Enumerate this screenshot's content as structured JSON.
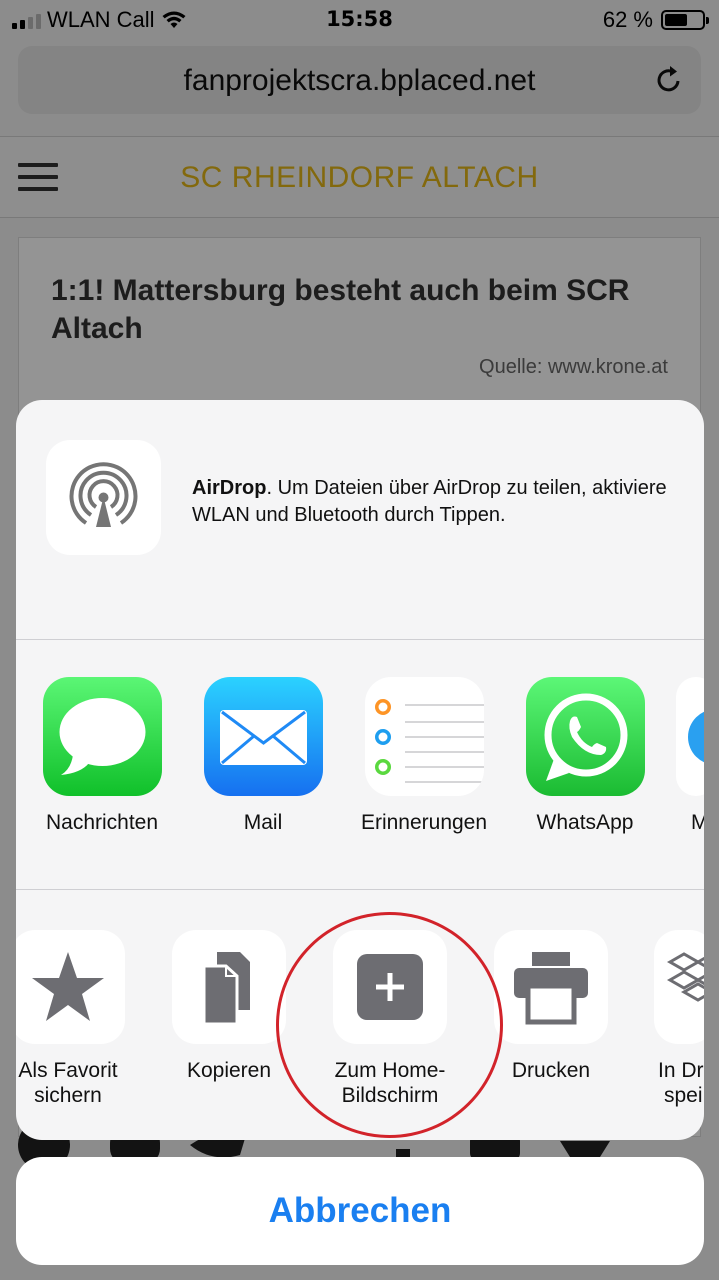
{
  "status_bar": {
    "carrier": "WLAN Call",
    "time": "15:58",
    "battery_percent": "62 %",
    "battery_level": 0.62
  },
  "browser": {
    "url": "fanprojektscra.bplaced.net",
    "reload_icon": "reload-icon"
  },
  "site": {
    "title": "SC RHEINDORF ALTACH",
    "title_color": "#e2b517",
    "menu_icon": "hamburger-menu-icon"
  },
  "article": {
    "title": "1:1! Mattersburg besteht auch beim SCR Altach",
    "source": "Quelle: www.krone.at"
  },
  "share_sheet": {
    "airdrop": {
      "bold": "AirDrop",
      "text": ". Um Dateien über AirDrop zu teilen, aktiviere WLAN und Bluetooth durch Tippen."
    },
    "apps": [
      {
        "label": "Nachrichten",
        "icon": "messages-icon"
      },
      {
        "label": "Mail",
        "icon": "mail-icon"
      },
      {
        "label": "Erinnerungen",
        "icon": "reminders-icon"
      },
      {
        "label": "WhatsApp",
        "icon": "whatsapp-icon"
      },
      {
        "label": "M",
        "icon": "partial-app-icon"
      }
    ],
    "actions": [
      {
        "line1": "Als Favorit",
        "line2": "sichern",
        "icon": "star-icon"
      },
      {
        "line1": "Kopieren",
        "line2": "",
        "icon": "copy-icon"
      },
      {
        "line1": "Zum Home-",
        "line2": "Bildschirm",
        "icon": "add-to-home-icon"
      },
      {
        "line1": "Drucken",
        "line2": "",
        "icon": "print-icon"
      },
      {
        "line1": "In Dr",
        "line2": "spei",
        "icon": "dropbox-icon"
      }
    ],
    "cancel_label": "Abbrechen",
    "accent_color": "#1a7ff0",
    "highlight_color": "#d2232a"
  }
}
